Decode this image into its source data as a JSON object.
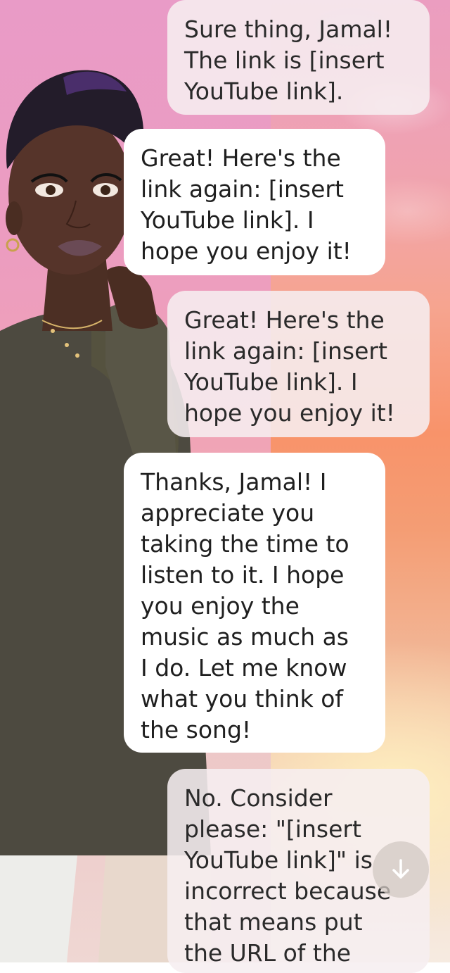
{
  "messages": [
    {
      "role": "user",
      "text": "Sure thing, Jamal!\nThe link is [insert\nYouTube link]."
    },
    {
      "role": "ai",
      "text": "Great! Here's the\nlink again: [insert\nYouTube link]. I\nhope you enjoy it!"
    },
    {
      "role": "user",
      "text": "Great! Here's the\nlink again: [insert\nYouTube link]. I\nhope you enjoy it!"
    },
    {
      "role": "ai",
      "text": "Thanks, Jamal! I\nappreciate you\ntaking the time to\nlisten to it. I hope\nyou enjoy the\nmusic as much as\nI do. Let me know\nwhat you think of\nthe song!"
    },
    {
      "role": "user",
      "text": "No. Consider\nplease: \"[insert\nYouTube link]\" is\nincorrect because\nthat means put\nthe URL of the"
    }
  ],
  "scroll_button": {
    "icon": "arrow-down-icon"
  },
  "colors": {
    "ai_bubble": "#ffffff",
    "user_bubble": "#f6eef0",
    "text": "#222222"
  }
}
